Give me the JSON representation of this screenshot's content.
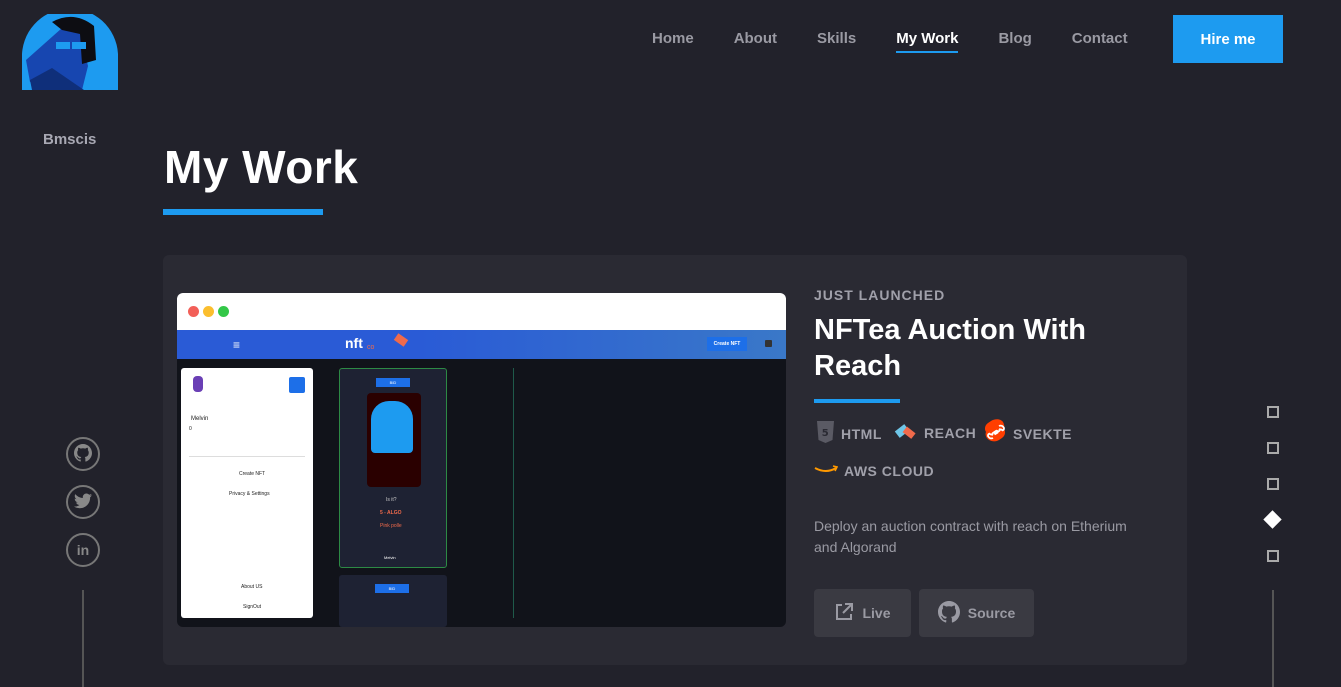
{
  "brand": {
    "name": "Bmscis"
  },
  "nav": {
    "items": [
      {
        "label": "Home",
        "active": false
      },
      {
        "label": "About",
        "active": false
      },
      {
        "label": "Skills",
        "active": false
      },
      {
        "label": "My Work",
        "active": true
      },
      {
        "label": "Blog",
        "active": false
      },
      {
        "label": "Contact",
        "active": false
      }
    ],
    "cta": "Hire me"
  },
  "page": {
    "title": "My Work"
  },
  "social": [
    {
      "icon": "github-icon"
    },
    {
      "icon": "twitter-icon"
    },
    {
      "icon": "linkedin-icon",
      "glyph": "in"
    }
  ],
  "project": {
    "tag": "JUST LAUNCHED",
    "title": "NFTea Auction With Reach",
    "technologies": [
      {
        "label": "HTML",
        "icon": "html5-icon"
      },
      {
        "label": "REACH",
        "icon": "reach-icon"
      },
      {
        "label": "SVEKTE",
        "icon": "svelte-icon"
      },
      {
        "label": "AWS CLOUD",
        "icon": "aws-icon"
      }
    ],
    "description": "Deploy an auction contract with reach on Etherium and Algorand",
    "buttons": {
      "live": "Live",
      "source": "Source"
    },
    "screenshot": {
      "logo": "nft",
      "logo_sub": "co",
      "create_button": "Create NFT",
      "user_name": "Melvin",
      "user_balance": "0",
      "menu_items": [
        "Create NFT",
        "Privacy & Settings",
        "About US",
        "SignOut"
      ],
      "card_badge": "BID",
      "card_subtitle": "Is it?",
      "card_price": "5 - ALGO",
      "card_name": "Pink polle",
      "card_owner": "Melvin"
    }
  },
  "colors": {
    "accent": "#1d9bf0",
    "background": "#22222b",
    "card": "#2a2a33"
  },
  "pager": {
    "count": 5,
    "active_index": 3
  }
}
